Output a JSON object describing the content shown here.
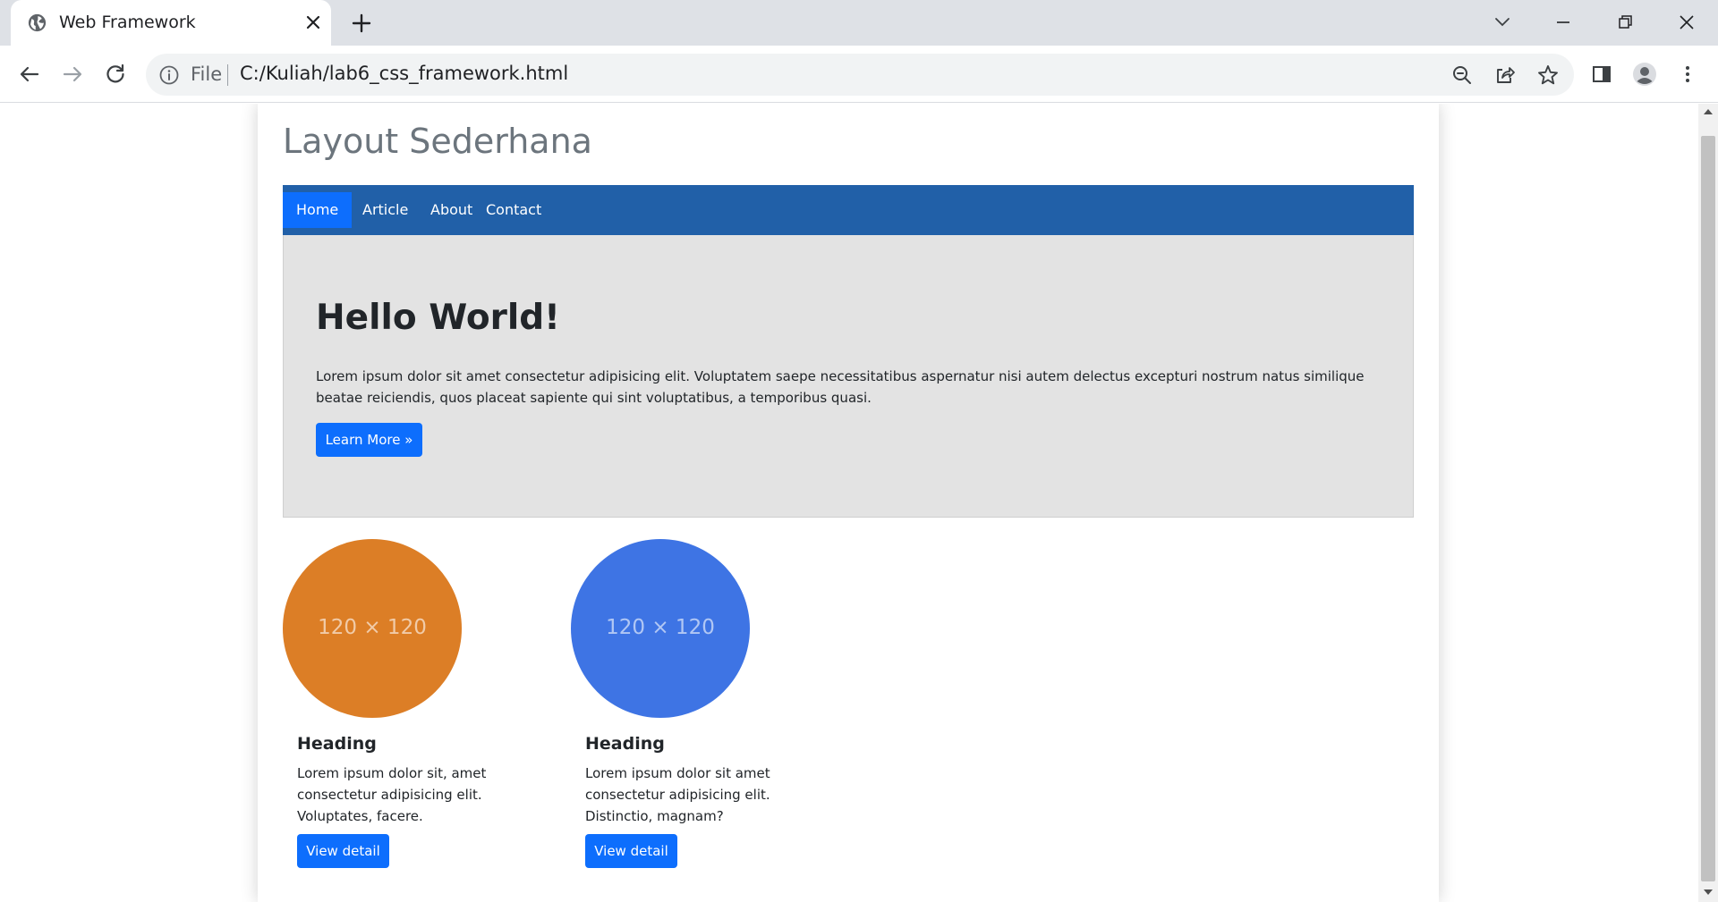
{
  "browser": {
    "tab_title": "Web Framework",
    "omnibox_scheme": "File",
    "url": "C:/Kuliah/lab6_css_framework.html"
  },
  "page": {
    "site_title": "Layout Sederhana",
    "nav": [
      {
        "label": "Home",
        "active": true
      },
      {
        "label": "Article",
        "active": false
      },
      {
        "label": "About",
        "active": false
      },
      {
        "label": "Contact",
        "active": false
      }
    ],
    "hero": {
      "title": "Hello World!",
      "text": "Lorem ipsum dolor sit amet consectetur adipisicing elit. Voluptatem saepe necessitatibus aspernatur nisi autem delectus excepturi nostrum natus similique beatae reiciendis, quos placeat sapiente qui sint voluptatibus, a temporibus quasi.",
      "button": "Learn More »"
    },
    "cards": [
      {
        "placeholder": "120 × 120",
        "color": "#dc7e26",
        "heading": "Heading",
        "text": "Lorem ipsum dolor sit, amet consectetur adipisicing elit. Voluptates, facere.",
        "button": "View detail"
      },
      {
        "placeholder": "120 × 120",
        "color": "#3e74e4",
        "heading": "Heading",
        "text": "Lorem ipsum dolor sit amet consectetur adipisicing elit. Distinctio, magnam?",
        "button": "View detail"
      }
    ]
  },
  "colors": {
    "navbar": "#2160a8",
    "primary": "#0d6efd",
    "hero_bg": "#e3e3e3"
  }
}
